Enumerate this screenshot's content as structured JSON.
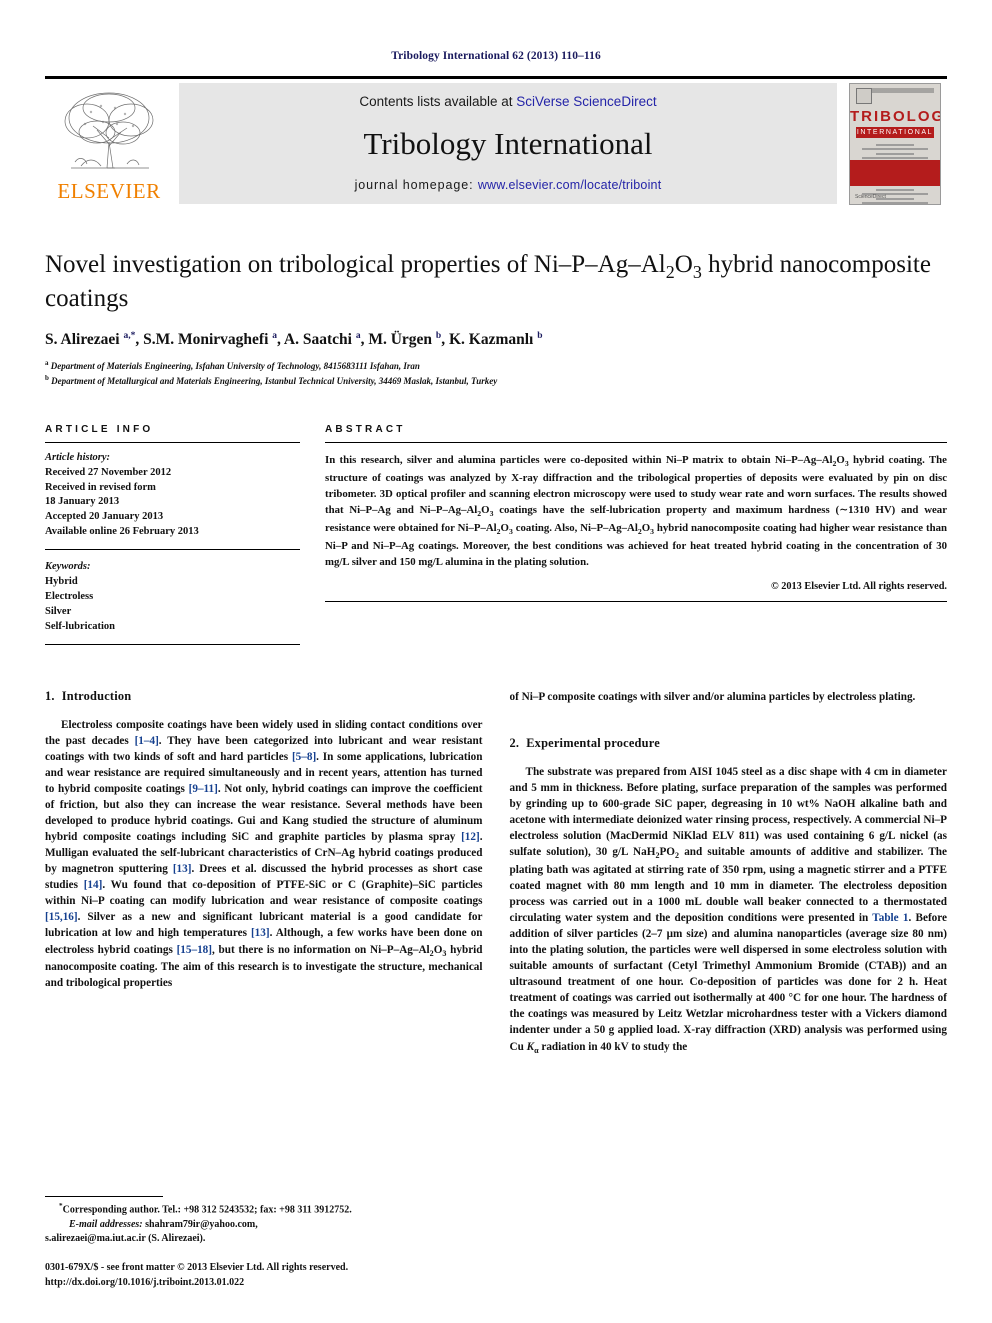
{
  "running_head": "Tribology International 62 (2013) 110–116",
  "masthead": {
    "publisher_name": "ELSEVIER",
    "contents_prefix": "Contents lists available at ",
    "contents_link": "SciVerse ScienceDirect",
    "journal_title": "Tribology International",
    "homepage_prefix": "journal homepage: ",
    "homepage_url": "www.elsevier.com/locate/triboint",
    "cover": {
      "title_line1": "TRIBOLOGY",
      "title_line2": "INTERNATIONAL",
      "footer": "ScienceDirect"
    },
    "colors": {
      "elsevier_orange": "#f08000",
      "link_blue": "#2424a8",
      "cover_red": "#b41c1c",
      "panel_grey": "#e6e6e6"
    }
  },
  "article": {
    "title_part1": "Novel investigation on tribological properties of Ni–P–Ag–Al",
    "title_sub1": "2",
    "title_part2": "O",
    "title_sub2": "3",
    "title_part3": " hybrid nanocomposite coatings",
    "authors_html": "S. Alirezaei <sup>a,*</sup>, S.M. Monirvaghefi <sup>a</sup>, A. Saatchi <sup>a</sup>, M. Ürgen <sup>b</sup>, K. Kazmanlı <sup>b</sup>",
    "affiliations": [
      {
        "marker": "a",
        "text": "Department of Materials Engineering, Isfahan University of Technology, 8415683111 Isfahan, Iran"
      },
      {
        "marker": "b",
        "text": "Department of Metallurgical and Materials Engineering, Istanbul Technical University, 34469 Maslak, Istanbul, Turkey"
      }
    ]
  },
  "article_info": {
    "heading": "ARTICLE INFO",
    "history_label": "Article history:",
    "history": [
      "Received 27 November 2012",
      "Received in revised form",
      "18 January 2013",
      "Accepted 20 January 2013",
      "Available online 26 February 2013"
    ],
    "keywords_label": "Keywords:",
    "keywords": [
      "Hybrid",
      "Electroless",
      "Silver",
      "Self-lubrication"
    ]
  },
  "abstract": {
    "heading": "ABSTRACT",
    "body_html": "In this research, silver and alumina particles were co-deposited within Ni–P matrix to obtain Ni–P–Ag–Al<sub>2</sub>O<sub>3</sub> hybrid coating. The structure of coatings was analyzed by X-ray diffraction and the tribological properties of deposits were evaluated by pin on disc tribometer. 3D optical profiler and scanning electron microscopy were used to study wear rate and worn surfaces. The results showed that Ni–P–Ag and Ni–P–Ag–Al<sub>2</sub>O<sub>3</sub> coatings have the self-lubrication property and maximum hardness (∼1310 HV) and wear resistance were obtained for Ni–P–Al<sub>2</sub>O<sub>3</sub> coating. Also, Ni–P–Ag–Al<sub>2</sub>O<sub>3</sub> hybrid nanocomposite coating had higher wear resistance than Ni–P and Ni–P–Ag coatings. Moreover, the best conditions was achieved for heat treated hybrid coating in the concentration of 30 mg/L silver and 150 mg/L alumina in the plating solution.",
    "copyright": "© 2013 Elsevier Ltd. All rights reserved."
  },
  "sections": {
    "introduction": {
      "number": "1.",
      "title": "Introduction",
      "paragraph_html": "Electroless composite coatings have been widely used in sliding contact conditions over the past decades <span class=\"ref\">[1–4]</span>. They have been categorized into lubricant and wear resistant coatings with two kinds of soft and hard particles <span class=\"ref\">[5–8]</span>. In some applications, lubrication and wear resistance are required simultaneously and in recent years, attention has turned to hybrid composite coatings <span class=\"ref\">[9–11]</span>. Not only, hybrid coatings can improve the coefficient of friction, but also they can increase the wear resistance. Several methods have been developed to produce hybrid coatings. Gui and Kang studied the structure of aluminum hybrid composite coatings including SiC and graphite particles by plasma spray <span class=\"ref\">[12]</span>. Mulligan evaluated the self-lubricant characteristics of CrN–Ag hybrid coatings produced by magnetron sputtering <span class=\"ref\">[13]</span>. Drees et al. discussed the hybrid processes as short case studies <span class=\"ref\">[14]</span>. Wu found that co-deposition of PTFE-SiC or C (Graphite)–SiC particles within Ni–P coating can modify lubrication and wear resistance of composite coatings <span class=\"ref\">[15,16]</span>. Silver as a new and significant lubricant material is a good candidate for lubrication at low and high temperatures <span class=\"ref\">[13]</span>. Although, a few works have been done on electroless hybrid coatings <span class=\"ref\">[15–18]</span>, but there is no information on Ni–P–Ag–Al<sub>2</sub>O<sub>3</sub> hybrid nanocomposite coating. The aim of this research is to investigate the structure, mechanical and tribological properties",
      "continuation_html": "of Ni–P composite coatings with silver and/or alumina particles by electroless plating."
    },
    "experimental": {
      "number": "2.",
      "title": "Experimental procedure",
      "paragraph_html": "The substrate was prepared from AISI 1045 steel as a disc shape with 4 cm in diameter and 5 mm in thickness. Before plating, surface preparation of the samples was performed by grinding up to 600-grade SiC paper, degreasing in 10 wt% NaOH alkaline bath and acetone with intermediate deionized water rinsing process, respectively. A commercial Ni–P electroless solution (MacDermid NiKlad ELV 811) was used containing 6 g/L nickel (as sulfate solution), 30 g/L NaH<sub>2</sub>PO<sub>2</sub> and suitable amounts of additive and stabilizer. The plating bath was agitated at stirring rate of 350 rpm, using a magnetic stirrer and a PTFE coated magnet with 80 mm length and 10 mm in diameter. The electroless deposition process was carried out in a 1000 mL double wall beaker connected to a thermostated circulating water system and the deposition conditions were presented in <span class=\"tlink\">Table 1</span>. Before addition of silver particles (2–7 μm size) and alumina nanoparticles (average size 80 nm) into the plating solution, the particles were well dispersed in some electroless solution with suitable amounts of surfactant (Cetyl Trimethyl Ammonium Bromide (CTAB)) and an ultrasound treatment of one hour. Co-deposition of particles was done for 2 h. Heat treatment of coatings was carried out isothermally at 400 °C for one hour. The hardness of the coatings was measured by Leitz Wetzlar microhardness tester with a Vickers diamond indenter under a 50 g applied load. X-ray diffraction (XRD) analysis was performed using Cu <i>K</i><sub>α</sub> radiation in 40 kV to study the"
    }
  },
  "footnote": {
    "corresponding_html": "<sup class=\"ch\">*</sup>Corresponding author. Tel.: +98 312 5243532; fax: +98 311 3912752.",
    "email_label": "E-mail addresses:",
    "email1": "shahram79ir@yahoo.com,",
    "email2": "s.alirezaei@ma.iut.ac.ir (S. Alirezaei).",
    "issn_line": "0301-679X/$ - see front matter © 2013 Elsevier Ltd. All rights reserved.",
    "doi_line": "http://dx.doi.org/10.1016/j.triboint.2013.01.022"
  }
}
